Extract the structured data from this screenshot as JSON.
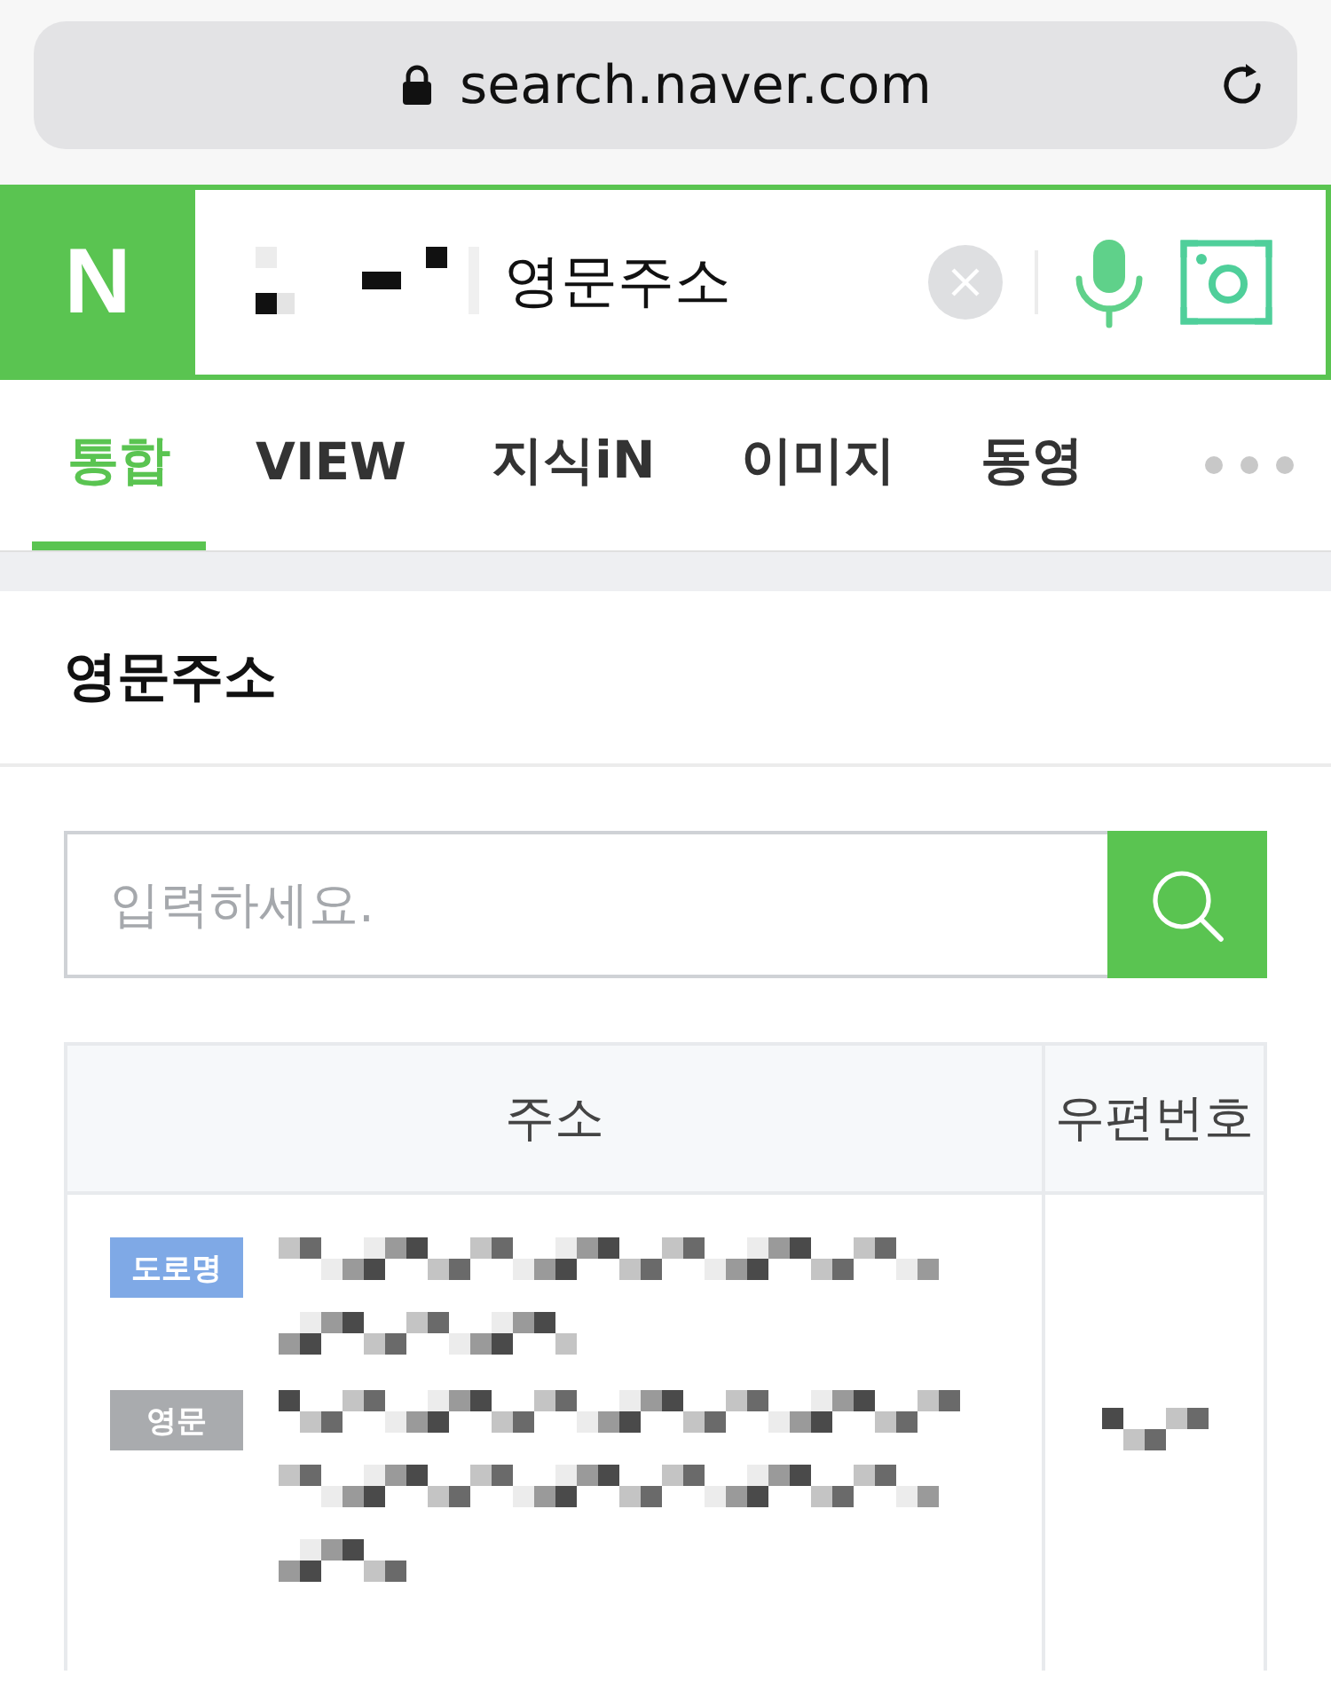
{
  "browser": {
    "url": "search.naver.com"
  },
  "header": {
    "logo": "N",
    "query": "영문주소"
  },
  "tabs": [
    {
      "label": "통합",
      "selected": true
    },
    {
      "label": "VIEW",
      "selected": false
    },
    {
      "label": "지식iN",
      "selected": false
    },
    {
      "label": "이미지",
      "selected": false
    },
    {
      "label": "동영",
      "selected": false
    }
  ],
  "section": {
    "title": "영문주소",
    "search": {
      "placeholder": "입력하세요."
    },
    "table": {
      "columns": [
        "주소",
        "우편번호"
      ],
      "rows": [
        {
          "tags": [
            {
              "label": "도로명",
              "color": "#7fa9e6"
            },
            {
              "label": "영문",
              "color": "#a9abae"
            }
          ]
        }
      ]
    }
  }
}
